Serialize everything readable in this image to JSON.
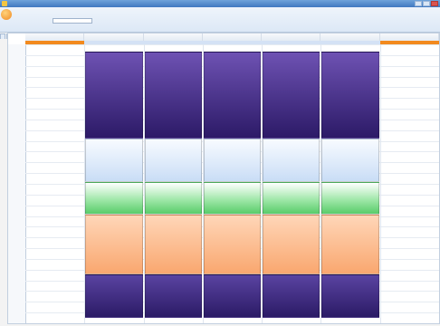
{
  "window": {
    "title": ""
  },
  "app": {
    "heading": ""
  },
  "toolbar": {
    "label": "",
    "field_value": ""
  },
  "tabs": [
    {
      "label": ""
    },
    {
      "label": ""
    },
    {
      "label": ""
    },
    {
      "label": ""
    },
    {
      "label": ""
    },
    {
      "label": ""
    }
  ],
  "calendar": {
    "days": [
      "",
      "",
      "",
      "",
      "",
      "",
      ""
    ],
    "time_labels": [
      "",
      "",
      "",
      "",
      "",
      "",
      "",
      "",
      "",
      "",
      "",
      "",
      "",
      "",
      "",
      "",
      "",
      "",
      "",
      "",
      "",
      "",
      "",
      "",
      "",
      ""
    ],
    "events": {
      "purple_block": "",
      "lightblue_block": "",
      "green_block": "",
      "orange_block": "",
      "dark_block": ""
    },
    "colors": {
      "purple": "#4b3592",
      "lightblue": "#dce9f9",
      "green": "#7fdb8c",
      "orange": "#f9b27c",
      "dark": "#3c2a82",
      "allday_highlight": "#f28a1e"
    }
  }
}
